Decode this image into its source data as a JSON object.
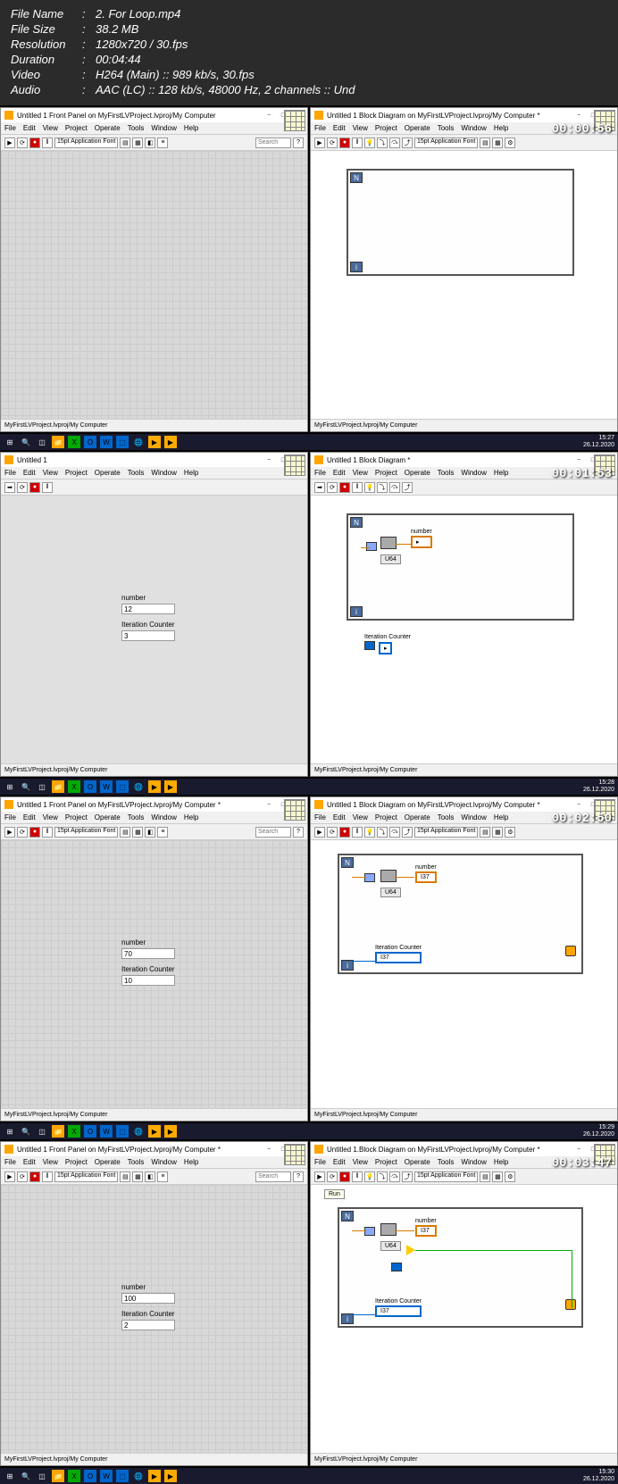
{
  "meta": {
    "filename_label": "File Name",
    "filename": "2. For Loop.mp4",
    "filesize_label": "File Size",
    "filesize": "38.2 MB",
    "resolution_label": "Resolution",
    "resolution": "1280x720 / 30.fps",
    "duration_label": "Duration",
    "duration": "00:04:44",
    "video_label": "Video",
    "video": "H264 (Main) :: 989 kb/s, 30.fps",
    "audio_label": "Audio",
    "audio": "AAC (LC) :: 128 kb/s, 48000 Hz, 2 channels :: Und",
    "sep": ":"
  },
  "titles": {
    "fp1": "Untitled 1 Front Panel on MyFirstLVProject.lvproj/My Computer",
    "bd1": "Untitled 1 Block Diagram on MyFirstLVProject.lvproj/My Computer *",
    "fp2": "Untitled 1",
    "bd2": "Untitled 1 Block Diagram *",
    "fp3": "Untitled 1 Front Panel on MyFirstLVProject.lvproj/My Computer *",
    "bd3": "Untitled 1 Block Diagram on MyFirstLVProject.lvproj/My Computer *",
    "fp4": "Untitled 1 Front Panel on MyFirstLVProject.lvproj/My Computer *",
    "bd4": "Untitled 1.Block Diagram on MyFirstLVProject.lvproj/My Computer *"
  },
  "menu": {
    "file": "File",
    "edit": "Edit",
    "view": "View",
    "project": "Project",
    "operate": "Operate",
    "tools": "Tools",
    "window": "Window",
    "help": "Help"
  },
  "toolbar": {
    "font": "15pt Application Font",
    "search": "Search"
  },
  "status": {
    "project": "MyFirstLVProject.lvproj/My Computer"
  },
  "timestamps": {
    "f1": "00:00:56",
    "f2": "00:01:53",
    "f3": "00:02:50",
    "f4": "00:03:47"
  },
  "clock": {
    "t1": "15:27",
    "d1": "26.12.2020",
    "t2": "15:28",
    "d2": "26.12.2020",
    "t3": "15:29",
    "d3": "26.12.2020",
    "t4": "15:30",
    "d4": "26.12.2020"
  },
  "nodes": {
    "number_label": "number",
    "iteration_label": "Iteration Counter",
    "n_symbol": "N",
    "i_symbol": "i",
    "u64": "U64",
    "i37": "I37",
    "run": "Run"
  },
  "fp_values": {
    "f2_number": "12",
    "f2_iter": "3",
    "f3_number": "70",
    "f3_iter": "10",
    "f4_number": "100",
    "f4_iter": "2"
  }
}
